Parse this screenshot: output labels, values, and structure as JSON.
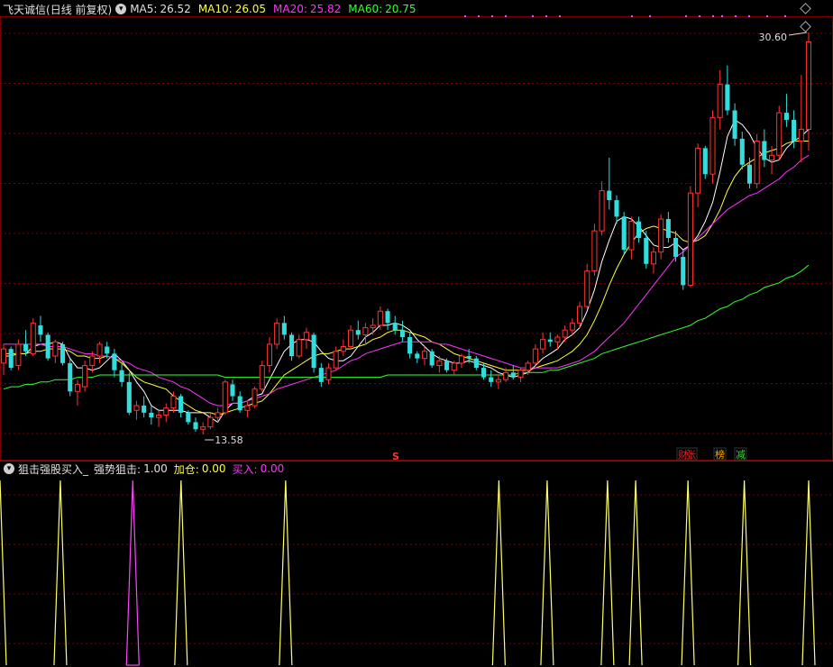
{
  "header": {
    "stock_name": "飞天诚信",
    "period": "(日线 前复权)",
    "ma5_label": "MA5:",
    "ma5_value": "26.52",
    "ma10_label": "MA10:",
    "ma10_value": "26.05",
    "ma20_label": "MA20:",
    "ma20_value": "25.82",
    "ma60_label": "MA60:",
    "ma60_value": "20.75"
  },
  "indicator_header": {
    "name": "狙击强股买入_",
    "s1_label": "强势狙击:",
    "s1_value": "1.00",
    "s2_label": "加仓:",
    "s2_value": "0.00",
    "s3_label": "买入:",
    "s3_value": "0.00"
  },
  "colors": {
    "ma5": "#ffffff",
    "ma10": "#ffff33",
    "ma20": "#ff33ff",
    "ma60": "#33ff33",
    "up": "#ff3333",
    "down": "#33dddd",
    "grid": "#7a0000",
    "signal_yellow": "#ffff66",
    "signal_magenta": "#ff44ff"
  },
  "markers": {
    "s_marker": "S",
    "tag_cai": "财",
    "tag_zhang": "张",
    "tag_bang": "榜",
    "tag_jian": "减"
  },
  "chart_data": {
    "type": "candlestick",
    "annotations": {
      "high_label": "30.60",
      "low_label": "13.58"
    },
    "candles": [
      [
        16.6,
        17.4,
        16.1,
        17.2
      ],
      [
        17.2,
        17.3,
        16.3,
        16.4
      ],
      [
        16.5,
        17.6,
        16.3,
        17.4
      ],
      [
        17.4,
        18.0,
        16.9,
        17.1
      ],
      [
        17.0,
        18.5,
        16.9,
        18.3
      ],
      [
        18.2,
        18.6,
        17.5,
        17.8
      ],
      [
        17.8,
        17.9,
        16.7,
        16.8
      ],
      [
        16.9,
        17.6,
        16.6,
        17.5
      ],
      [
        17.4,
        17.5,
        16.5,
        16.6
      ],
      [
        16.6,
        16.8,
        15.2,
        15.4
      ],
      [
        15.4,
        15.9,
        14.8,
        15.7
      ],
      [
        15.6,
        16.7,
        15.4,
        16.5
      ],
      [
        16.5,
        17.1,
        16.2,
        16.9
      ],
      [
        16.9,
        17.5,
        16.6,
        17.4
      ],
      [
        17.3,
        17.5,
        16.8,
        17.0
      ],
      [
        17.0,
        17.2,
        16.0,
        16.3
      ],
      [
        16.3,
        16.6,
        15.6,
        15.8
      ],
      [
        15.8,
        16.2,
        14.4,
        14.5
      ],
      [
        14.6,
        15.0,
        14.2,
        14.8
      ],
      [
        14.8,
        15.2,
        14.3,
        14.5
      ],
      [
        14.5,
        14.8,
        14.0,
        14.3
      ],
      [
        14.3,
        14.6,
        13.9,
        14.4
      ],
      [
        14.4,
        14.9,
        14.1,
        14.7
      ],
      [
        14.7,
        15.4,
        14.5,
        15.2
      ],
      [
        15.2,
        15.3,
        14.3,
        14.5
      ],
      [
        14.5,
        14.6,
        14.0,
        14.1
      ],
      [
        14.1,
        14.3,
        13.7,
        13.8
      ],
      [
        13.8,
        14.1,
        13.58,
        13.9
      ],
      [
        13.9,
        14.5,
        13.8,
        14.3
      ],
      [
        14.3,
        14.7,
        14.1,
        14.5
      ],
      [
        14.5,
        15.9,
        14.4,
        15.8
      ],
      [
        15.7,
        15.9,
        15.0,
        15.2
      ],
      [
        15.2,
        15.4,
        14.5,
        14.6
      ],
      [
        14.6,
        15.0,
        14.3,
        14.8
      ],
      [
        14.8,
        15.6,
        14.7,
        15.5
      ],
      [
        15.5,
        16.7,
        15.4,
        16.5
      ],
      [
        16.5,
        17.7,
        16.2,
        17.4
      ],
      [
        17.4,
        18.5,
        17.2,
        18.3
      ],
      [
        18.3,
        18.6,
        17.6,
        17.8
      ],
      [
        17.8,
        17.9,
        16.7,
        16.9
      ],
      [
        16.9,
        17.8,
        16.8,
        17.6
      ],
      [
        17.6,
        18.1,
        17.2,
        17.9
      ],
      [
        17.8,
        17.9,
        16.2,
        16.4
      ],
      [
        16.4,
        16.6,
        15.6,
        15.8
      ],
      [
        15.9,
        16.6,
        15.7,
        16.4
      ],
      [
        16.4,
        17.3,
        16.3,
        17.1
      ],
      [
        17.1,
        17.6,
        16.9,
        17.3
      ],
      [
        17.3,
        18.2,
        17.2,
        18.0
      ],
      [
        18.0,
        18.4,
        17.6,
        17.8
      ],
      [
        17.8,
        18.3,
        17.4,
        18.1
      ],
      [
        18.1,
        18.5,
        17.8,
        18.2
      ],
      [
        18.2,
        19.0,
        18.0,
        18.8
      ],
      [
        18.8,
        18.9,
        18.0,
        18.3
      ],
      [
        18.3,
        18.6,
        17.8,
        18.0
      ],
      [
        18.0,
        18.4,
        17.5,
        17.7
      ],
      [
        17.7,
        17.9,
        16.8,
        17.0
      ],
      [
        17.0,
        17.1,
        16.6,
        16.8
      ],
      [
        16.8,
        17.3,
        16.5,
        17.1
      ],
      [
        17.1,
        17.2,
        16.4,
        16.5
      ],
      [
        16.5,
        16.9,
        16.2,
        16.7
      ],
      [
        16.7,
        16.8,
        16.2,
        16.3
      ],
      [
        16.3,
        16.7,
        16.1,
        16.6
      ],
      [
        16.6,
        17.0,
        16.4,
        16.9
      ],
      [
        16.9,
        17.2,
        16.6,
        16.8
      ],
      [
        16.8,
        16.9,
        16.3,
        16.4
      ],
      [
        16.4,
        16.6,
        15.9,
        16.0
      ],
      [
        16.0,
        16.3,
        15.6,
        15.8
      ],
      [
        15.8,
        16.1,
        15.5,
        15.9
      ],
      [
        15.9,
        16.4,
        15.8,
        16.2
      ],
      [
        16.2,
        16.5,
        15.9,
        16.0
      ],
      [
        16.0,
        16.4,
        15.8,
        16.3
      ],
      [
        16.3,
        16.7,
        16.1,
        16.6
      ],
      [
        16.6,
        17.4,
        16.5,
        17.2
      ],
      [
        17.2,
        17.9,
        17.0,
        17.6
      ],
      [
        17.6,
        17.9,
        17.3,
        17.5
      ],
      [
        17.5,
        17.8,
        17.2,
        17.7
      ],
      [
        17.7,
        18.2,
        17.5,
        18.0
      ],
      [
        18.0,
        18.5,
        17.8,
        18.3
      ],
      [
        18.3,
        19.2,
        18.1,
        19.0
      ],
      [
        19.0,
        20.8,
        18.9,
        20.5
      ],
      [
        20.5,
        22.5,
        20.3,
        22.2
      ],
      [
        22.2,
        24.3,
        22.0,
        23.9
      ],
      [
        23.9,
        25.3,
        23.1,
        23.5
      ],
      [
        23.5,
        23.7,
        22.5,
        22.8
      ],
      [
        22.8,
        23.0,
        21.2,
        21.4
      ],
      [
        21.4,
        22.8,
        21.0,
        22.6
      ],
      [
        22.6,
        22.8,
        21.7,
        21.9
      ],
      [
        21.9,
        22.2,
        20.6,
        20.8
      ],
      [
        20.8,
        21.5,
        20.4,
        21.3
      ],
      [
        21.3,
        22.9,
        21.0,
        22.7
      ],
      [
        22.7,
        23.0,
        21.7,
        21.9
      ],
      [
        21.9,
        22.2,
        20.9,
        21.1
      ],
      [
        21.1,
        21.4,
        19.7,
        19.9
      ],
      [
        19.9,
        24.1,
        19.8,
        23.8
      ],
      [
        23.8,
        25.9,
        23.2,
        25.7
      ],
      [
        25.7,
        25.8,
        24.4,
        24.6
      ],
      [
        24.6,
        27.3,
        24.2,
        27.0
      ],
      [
        27.0,
        29.0,
        26.5,
        28.4
      ],
      [
        28.4,
        29.2,
        27.1,
        27.3
      ],
      [
        27.3,
        27.6,
        25.8,
        26.1
      ],
      [
        26.1,
        26.4,
        24.8,
        25.0
      ],
      [
        25.0,
        25.3,
        24.0,
        24.2
      ],
      [
        24.2,
        26.3,
        24.0,
        26.0
      ],
      [
        26.0,
        26.5,
        24.9,
        25.2
      ],
      [
        25.2,
        25.8,
        24.6,
        25.4
      ],
      [
        25.4,
        27.5,
        25.2,
        27.2
      ],
      [
        27.2,
        28.0,
        26.6,
        26.9
      ],
      [
        26.9,
        27.3,
        25.7,
        26.0
      ],
      [
        26.0,
        28.8,
        25.1,
        26.5
      ],
      [
        26.5,
        30.6,
        25.6,
        30.2
      ]
    ],
    "ma_series": [
      {
        "name": "MA5",
        "values": [
          16.9,
          16.9,
          17.0,
          17.0,
          17.3,
          17.4,
          17.4,
          17.5,
          17.4,
          16.8,
          16.4,
          16.4,
          16.3,
          16.4,
          16.7,
          17.0,
          16.7,
          16.3,
          15.8,
          15.4,
          14.8,
          14.6,
          14.6,
          14.6,
          14.6,
          14.5,
          14.5,
          14.5,
          14.3,
          14.1,
          14.6,
          14.9,
          14.9,
          15.0,
          15.2,
          15.3,
          15.9,
          16.5,
          17.1,
          17.4,
          17.6,
          17.6,
          17.5,
          17.1,
          16.8,
          16.7,
          16.7,
          16.9,
          17.3,
          17.7,
          17.9,
          18.2,
          18.2,
          18.3,
          18.2,
          18.0,
          17.6,
          17.3,
          17.0,
          16.8,
          16.7,
          16.6,
          16.6,
          16.7,
          16.6,
          16.5,
          16.4,
          16.2,
          16.1,
          16.0,
          16.1,
          16.2,
          16.5,
          16.8,
          17.0,
          17.2,
          17.6,
          17.8,
          18.1,
          18.8,
          19.7,
          20.9,
          21.8,
          22.6,
          22.8,
          22.7,
          22.4,
          22.0,
          21.6,
          21.5,
          21.5,
          21.7,
          21.4,
          21.6,
          22.0,
          22.6,
          23.4,
          24.7,
          26.2,
          26.9,
          26.7,
          26.3,
          25.7,
          25.3,
          25.1,
          25.2,
          25.7,
          26.0,
          26.2,
          26.5
        ]
      },
      {
        "name": "MA10",
        "values": [
          17.0,
          17.0,
          17.0,
          17.0,
          17.1,
          17.1,
          17.2,
          17.2,
          17.2,
          17.1,
          16.9,
          16.9,
          16.8,
          16.8,
          16.9,
          16.8,
          16.6,
          16.3,
          16.0,
          15.8,
          15.7,
          15.6,
          15.5,
          15.2,
          15.0,
          14.8,
          14.6,
          14.5,
          14.5,
          14.4,
          14.5,
          14.6,
          14.7,
          14.8,
          14.9,
          15.0,
          15.3,
          15.7,
          16.1,
          16.3,
          16.5,
          16.7,
          16.9,
          17.0,
          17.0,
          17.1,
          17.2,
          17.2,
          17.3,
          17.4,
          17.6,
          17.7,
          17.9,
          18.0,
          18.0,
          17.9,
          17.8,
          17.7,
          17.5,
          17.4,
          17.2,
          17.0,
          16.9,
          16.8,
          16.7,
          16.6,
          16.5,
          16.4,
          16.3,
          16.3,
          16.3,
          16.3,
          16.4,
          16.5,
          16.6,
          16.7,
          16.9,
          17.1,
          17.4,
          17.8,
          18.4,
          19.1,
          19.9,
          20.6,
          21.2,
          21.7,
          22.1,
          22.3,
          22.4,
          22.3,
          22.2,
          22.1,
          21.8,
          21.7,
          21.8,
          22.0,
          22.5,
          23.1,
          23.9,
          24.5,
          24.9,
          25.1,
          25.3,
          25.5,
          25.6,
          25.7,
          25.9,
          26.0,
          26.0,
          26.0
        ]
      },
      {
        "name": "MA20",
        "values": [
          17.4,
          17.4,
          17.4,
          17.4,
          17.4,
          17.4,
          17.3,
          17.3,
          17.3,
          17.2,
          17.1,
          17.0,
          17.0,
          16.9,
          16.9,
          16.8,
          16.7,
          16.6,
          16.4,
          16.3,
          16.2,
          16.0,
          15.9,
          15.8,
          15.6,
          15.5,
          15.3,
          15.1,
          14.9,
          14.8,
          14.8,
          14.9,
          14.9,
          15.0,
          15.1,
          15.2,
          15.3,
          15.5,
          15.6,
          15.7,
          15.8,
          15.9,
          16.0,
          16.1,
          16.2,
          16.3,
          16.5,
          16.7,
          16.8,
          17.0,
          17.1,
          17.2,
          17.3,
          17.4,
          17.5,
          17.5,
          17.5,
          17.5,
          17.5,
          17.4,
          17.4,
          17.3,
          17.2,
          17.1,
          17.0,
          16.9,
          16.8,
          16.7,
          16.6,
          16.5,
          16.4,
          16.4,
          16.4,
          16.4,
          16.4,
          16.4,
          16.5,
          16.6,
          16.7,
          16.9,
          17.1,
          17.4,
          17.7,
          18.0,
          18.3,
          18.7,
          19.1,
          19.5,
          19.9,
          20.3,
          20.7,
          21.1,
          21.3,
          21.6,
          21.9,
          22.2,
          22.5,
          22.8,
          23.1,
          23.3,
          23.5,
          23.7,
          23.8,
          24.0,
          24.2,
          24.4,
          24.7,
          24.9,
          25.2,
          25.4
        ]
      },
      {
        "name": "MA60",
        "values": [
          15.5,
          15.6,
          15.6,
          15.7,
          15.7,
          15.8,
          15.8,
          15.9,
          15.9,
          15.9,
          16.0,
          16.0,
          16.0,
          16.1,
          16.1,
          16.1,
          16.1,
          16.1,
          16.1,
          16.1,
          16.1,
          16.1,
          16.1,
          16.1,
          16.1,
          16.1,
          16.1,
          16.1,
          16.1,
          16.1,
          16.0,
          16.0,
          16.0,
          16.0,
          16.0,
          16.0,
          16.0,
          16.0,
          16.0,
          16.0,
          16.0,
          16.0,
          16.0,
          16.0,
          16.0,
          16.0,
          16.0,
          16.0,
          16.0,
          16.0,
          16.0,
          16.0,
          16.1,
          16.1,
          16.1,
          16.1,
          16.1,
          16.1,
          16.1,
          16.1,
          16.1,
          16.1,
          16.1,
          16.1,
          16.1,
          16.1,
          16.1,
          16.1,
          16.1,
          16.1,
          16.2,
          16.2,
          16.2,
          16.2,
          16.3,
          16.3,
          16.4,
          16.5,
          16.6,
          16.7,
          16.8,
          17.0,
          17.1,
          17.2,
          17.3,
          17.4,
          17.5,
          17.6,
          17.7,
          17.8,
          17.9,
          18.0,
          18.1,
          18.2,
          18.4,
          18.5,
          18.7,
          18.9,
          19.0,
          19.2,
          19.3,
          19.5,
          19.6,
          19.8,
          19.9,
          20.0,
          20.2,
          20.3,
          20.5,
          20.75
        ]
      }
    ],
    "signals": [
      {
        "index": 0,
        "type": "strong"
      },
      {
        "index": 15,
        "type": "strong"
      },
      {
        "index": 33,
        "type": "add"
      },
      {
        "index": 45,
        "type": "strong"
      },
      {
        "index": 71,
        "type": "strong"
      },
      {
        "index": 124,
        "type": "strong"
      },
      {
        "index": 136,
        "type": "strong"
      },
      {
        "index": 151,
        "type": "strong"
      },
      {
        "index": 158,
        "type": "strong"
      },
      {
        "index": 171,
        "type": "strong"
      },
      {
        "index": 185,
        "type": "strong"
      },
      {
        "index": 201,
        "type": "strong"
      }
    ]
  }
}
